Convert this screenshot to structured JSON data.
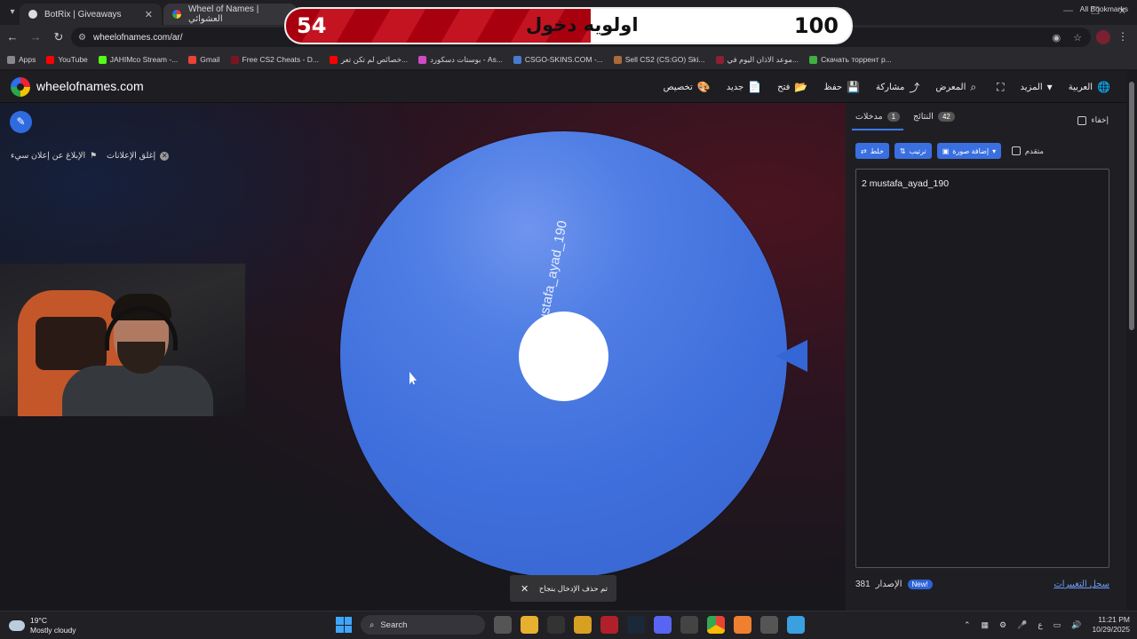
{
  "browser": {
    "tabs": [
      {
        "title": "BotRix | Giveaways"
      },
      {
        "title": "Wheel of Names | العشوائي"
      }
    ],
    "url": "wheelofnames.com/ar/",
    "bookmarks": [
      {
        "label": "Apps",
        "color": "#888888"
      },
      {
        "label": "YouTube",
        "color": "#ff0000"
      },
      {
        "label": "JAHIMco Stream -...",
        "color": "#53fc18"
      },
      {
        "label": "Gmail",
        "color": "#ea4335"
      },
      {
        "label": "Free CS2 Cheats - D...",
        "color": "#7a1520"
      },
      {
        "label": "خصائص لم تكن تعر...",
        "color": "#ff0000"
      },
      {
        "label": "بوستات دسكورد - As...",
        "color": "#d04ac8"
      },
      {
        "label": "CSGO-SKINS.COM -...",
        "color": "#4a7ad0"
      },
      {
        "label": "Sell CS2 (CS:GO) Ski...",
        "color": "#aa6a3a"
      },
      {
        "label": "موعد الاذان اليوم في...",
        "color": "#8a2030"
      },
      {
        "label": "Скачать торрент р...",
        "color": "#40b040"
      }
    ],
    "all_bookmarks": "All Bookmarks"
  },
  "site": {
    "name": "wheelofnames.com",
    "menu": [
      {
        "label": "العربية",
        "icon": "globe-icon",
        "glyph": "🌐"
      },
      {
        "label": "المزيد",
        "icon": "chevron-down-icon",
        "glyph": "▾"
      },
      {
        "label": "",
        "icon": "fullscreen-icon",
        "glyph": "⛶"
      },
      {
        "label": "المعرض",
        "icon": "search-icon",
        "glyph": "⌕"
      },
      {
        "label": "مشاركة",
        "icon": "share-icon",
        "glyph": "⤴"
      },
      {
        "label": "حفظ",
        "icon": "save-icon",
        "glyph": "💾"
      },
      {
        "label": "فتح",
        "icon": "folder-icon",
        "glyph": "📂"
      },
      {
        "label": "جديد",
        "icon": "new-file-icon",
        "glyph": "📄"
      },
      {
        "label": "تخصيص",
        "icon": "palette-icon",
        "glyph": "🎨"
      }
    ]
  },
  "stage": {
    "close_ads": "إغلق الإعلانات",
    "report_ad": "الإبلاغ عن إعلان سيء",
    "wheel_entry": "2 mustafa_ayad_190",
    "toast": "تم حذف الإدخال بنجاح"
  },
  "panel": {
    "hide_label": "إخفاء",
    "tabs": [
      {
        "label": "مدخلات",
        "count": "1"
      },
      {
        "label": "النتائج",
        "count": "42"
      }
    ],
    "tools": {
      "shuffle": "خلط",
      "sort": "ترتيب",
      "add_image": "إضافة صورة",
      "advanced": "متقدم"
    },
    "entries_text": "2 mustafa_ayad_190",
    "version_label": "الإصدار",
    "version_number": "381",
    "new_badge": "New!",
    "changelog": "سجل التغييرات"
  },
  "overlay": {
    "current": "54",
    "title": "اولويه دخول",
    "max": "100",
    "progress": 0.54,
    "fill_color": "#b30a18"
  },
  "taskbar": {
    "temperature": "19°C",
    "condition": "Mostly cloudy",
    "search_placeholder": "Search",
    "lang": "ع",
    "time": "11:21 PM",
    "date": "10/29/2025"
  },
  "colors": {
    "wheel": "#3f6fdc",
    "accent": "#3a6fe0"
  }
}
